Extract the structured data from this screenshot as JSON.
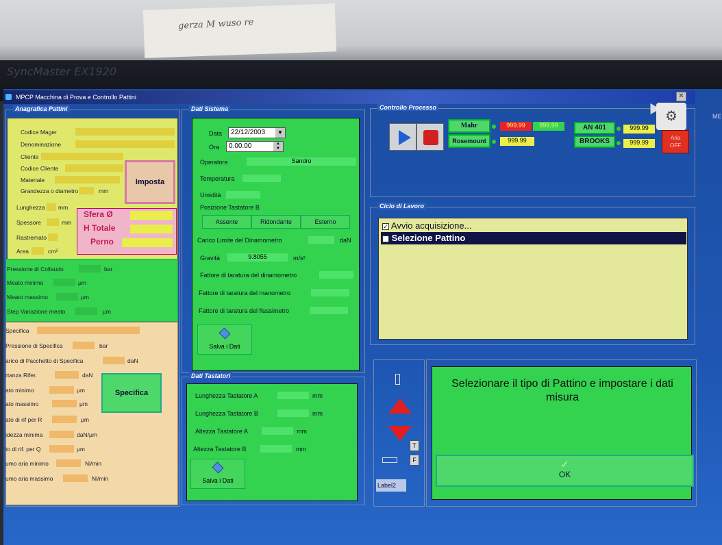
{
  "background": {
    "paper_note": "gerza M wuso re",
    "monitor_brand": "SyncMaster EX1920"
  },
  "window": {
    "title": "MPCP Macchina di Prova e Controllo Pattini",
    "close": "✕",
    "side_label": "ME"
  },
  "anagrafica": {
    "legend": "Anagrafica Pattini",
    "codice_mager": "Codice Mager",
    "denominazione": "Denominazione",
    "cliente": "Cliente",
    "codice_cliente": "Codice Cliente",
    "materiale": "Materiale",
    "grandezza": "Grandezza o diametro",
    "grandezza_unit": "mm",
    "imposta": "Imposta",
    "lunghezza": "Lunghezza",
    "lunghezza_unit": "mm",
    "spessore": "Spessore",
    "spessore_unit": "mm",
    "rastremato": "Rastremato",
    "area": "Area",
    "area_unit": "cm²",
    "sfera": "Sfera Ø",
    "h_totale": "H Totale",
    "perno": "Perno",
    "pressione_collaudo": "Pressione di Collaudo",
    "pressione_collaudo_unit": "bar",
    "meato_minimo": "Meato minimo",
    "meato_minimo_unit": "μm",
    "meato_massimo": "Meato massimo",
    "meato_massimo_unit": "μm",
    "step_variazione": "Step Variazione meato",
    "step_unit": "μm",
    "specifica": "Specifica",
    "pressione_specifica": "Pressione di Specifica",
    "pressione_specifica_unit": "bar",
    "carico_pacchetto": "arico di Pacchetto di Specifica",
    "carico_pacchetto_unit": "daN",
    "portanza": "rtanza Rifer.",
    "portanza_unit": "daN",
    "meato_min2": "ato minimo",
    "meato_min2_unit": "μm",
    "meato_max2": "ato massimo",
    "meato_max2_unit": "μm",
    "specifica_btn": "Specifica",
    "meato_rif_r": "ato di rif per R",
    "meato_rif_r_unit": "μm",
    "rigidezza": "idezza minima",
    "rigidezza_unit": "daN/μm",
    "meato_rif_q": "to di rif. per Q",
    "meato_rif_q_unit": "μm",
    "consumo_min": "umo aria minimo",
    "consumo_min_unit": "Nl/min",
    "consumo_max": "umo aria massimo",
    "consumo_max_unit": "Nl/min"
  },
  "dati_sistema": {
    "legend": "Dati Sistema",
    "data_label": "Data",
    "data_value": "22/12/2003",
    "ora_label": "Ora",
    "ora_value": "0.00.00",
    "operatore": "Operatore",
    "operatore_value": "Sandro",
    "temperatura": "Temperatura",
    "umidita": "Umidità",
    "posizione": "Posizione Tastatore B",
    "assente": "Assente",
    "ridondante": "Ridondante",
    "esterno": "Esterno",
    "carico_limite": "Carico Limite del Dinamometro",
    "carico_limite_unit": "daN",
    "gravita": "Gravità",
    "gravita_value": "9.8055",
    "gravita_unit": "m/s²",
    "fattore_dinamometro": "Fattore di taratura del dinamometro",
    "fattore_manometro": "Fattore di taratura del manometro",
    "fattore_flussimetro": "Fattore di taratura del flussimetro",
    "salva": "Salva i Dati"
  },
  "dati_tastatori": {
    "legend": "Dati Tastatori",
    "lunghezza_a": "Lunghezza Tastatore A",
    "lunghezza_b": "Lunghezza Tastatore B",
    "altezza_a": "Altezza Tastatore A",
    "altezza_b": "Altezza Tastatore B",
    "unit": "mm",
    "salva": "Salva i Dati"
  },
  "controllo": {
    "legend": "Controllo Processo",
    "mahr": "Mahr",
    "rosemount": "Rosemount",
    "val1": "999.99",
    "val2": "999.99",
    "val3": "999.99",
    "an401": "AN 401",
    "brooks": "BROOKS",
    "val4": "999.99",
    "val5": "999.99",
    "aria": "Aria",
    "off": "OFF"
  },
  "ciclo": {
    "legend": "Ciclo di Lavoro",
    "items": [
      {
        "label": "Avvio acquisizione...",
        "checked": true
      },
      {
        "label": "Selezione Pattino",
        "checked": false
      }
    ]
  },
  "bottom": {
    "t_btn": "T",
    "f_btn": "F",
    "label2": "Label2",
    "message": "Selezionare il tipo di Pattino e impostare i dati misura",
    "ok_check": "✓",
    "ok": "OK"
  },
  "colors": {
    "panel_green": "#33d24f",
    "panel_yellow": "#dfe86a",
    "panel_orange": "#f4d9a8",
    "pink_border": "#e59ab8"
  }
}
